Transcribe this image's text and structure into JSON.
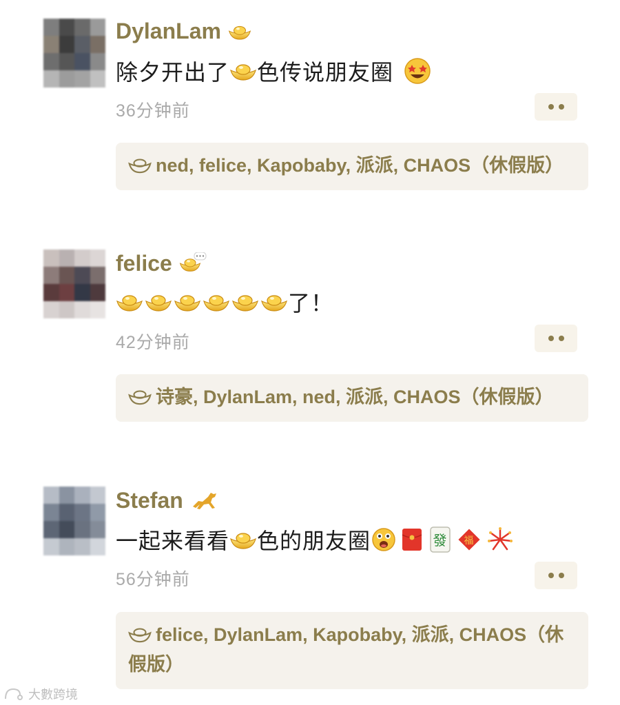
{
  "posts": [
    {
      "author": "DylanLam",
      "text_before": "除夕开出了",
      "text_after": "色传说朋友圈",
      "time": "36分钟前",
      "likes": "ned, felice, Kapobaby, 派派, CHAOS（休假版）"
    },
    {
      "author": "felice",
      "text_after": "了！",
      "time": "42分钟前",
      "likes": "诗豪, DylanLam, ned, 派派, CHAOS（休假版）"
    },
    {
      "author": "Stefan",
      "text_before": "一起来看看",
      "text_after": "色的朋友圈",
      "time": "56分钟前",
      "likes": "felice, DylanLam, Kapobaby, 派派, CHAOS（休假版）"
    }
  ],
  "watermark": "大數跨境",
  "colors": {
    "name": "#8b7d4c",
    "likes_bg": "#f5f2ec",
    "time": "#aaaaaa"
  }
}
